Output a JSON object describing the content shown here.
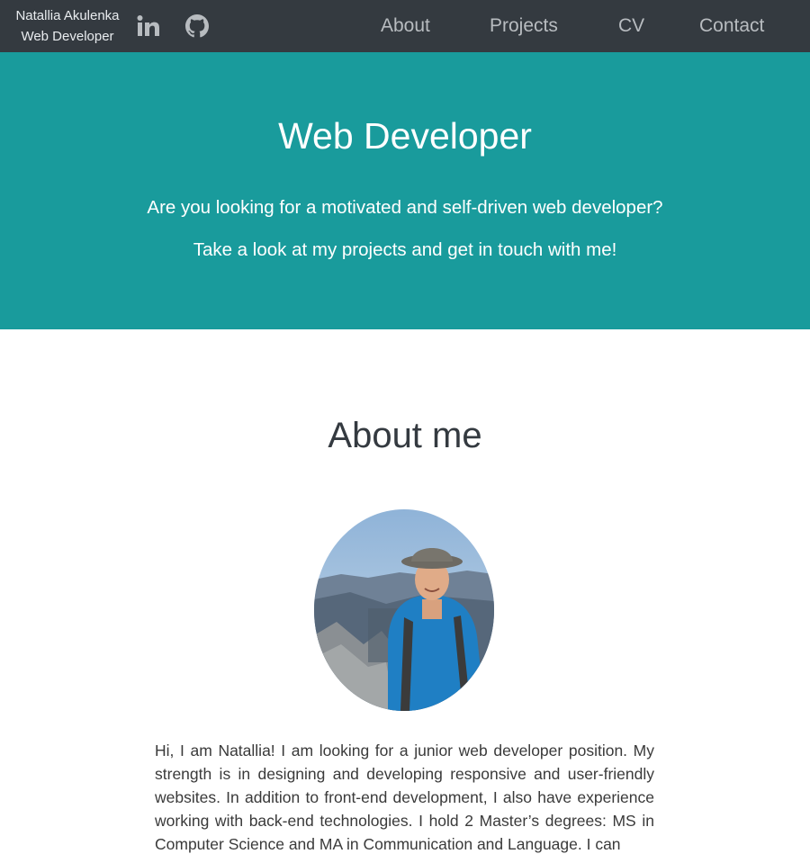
{
  "nav": {
    "brand_name": "Natallia Akulenka",
    "brand_role": "Web Developer",
    "social_icons": [
      "linkedin-icon",
      "github-icon"
    ],
    "links": [
      "About",
      "Projects",
      "CV",
      "Contact"
    ],
    "bg_color": "#343a40"
  },
  "hero": {
    "title": "Web Developer",
    "line1": "Are you looking for a motivated and self-driven web developer?",
    "line2": "Take a look at my projects and get in touch with me!",
    "bg_color": "#199b9c"
  },
  "about": {
    "title": "About me",
    "text": "Hi, I am Natallia! I am looking for a junior web developer position. My strength is in designing and developing responsive and user-friendly websites. In addition to front-end development, I also have experience working with back-end technologies. I hold 2 Master’s degrees: MS in Computer Science and MA in Communication and Language. I can"
  }
}
